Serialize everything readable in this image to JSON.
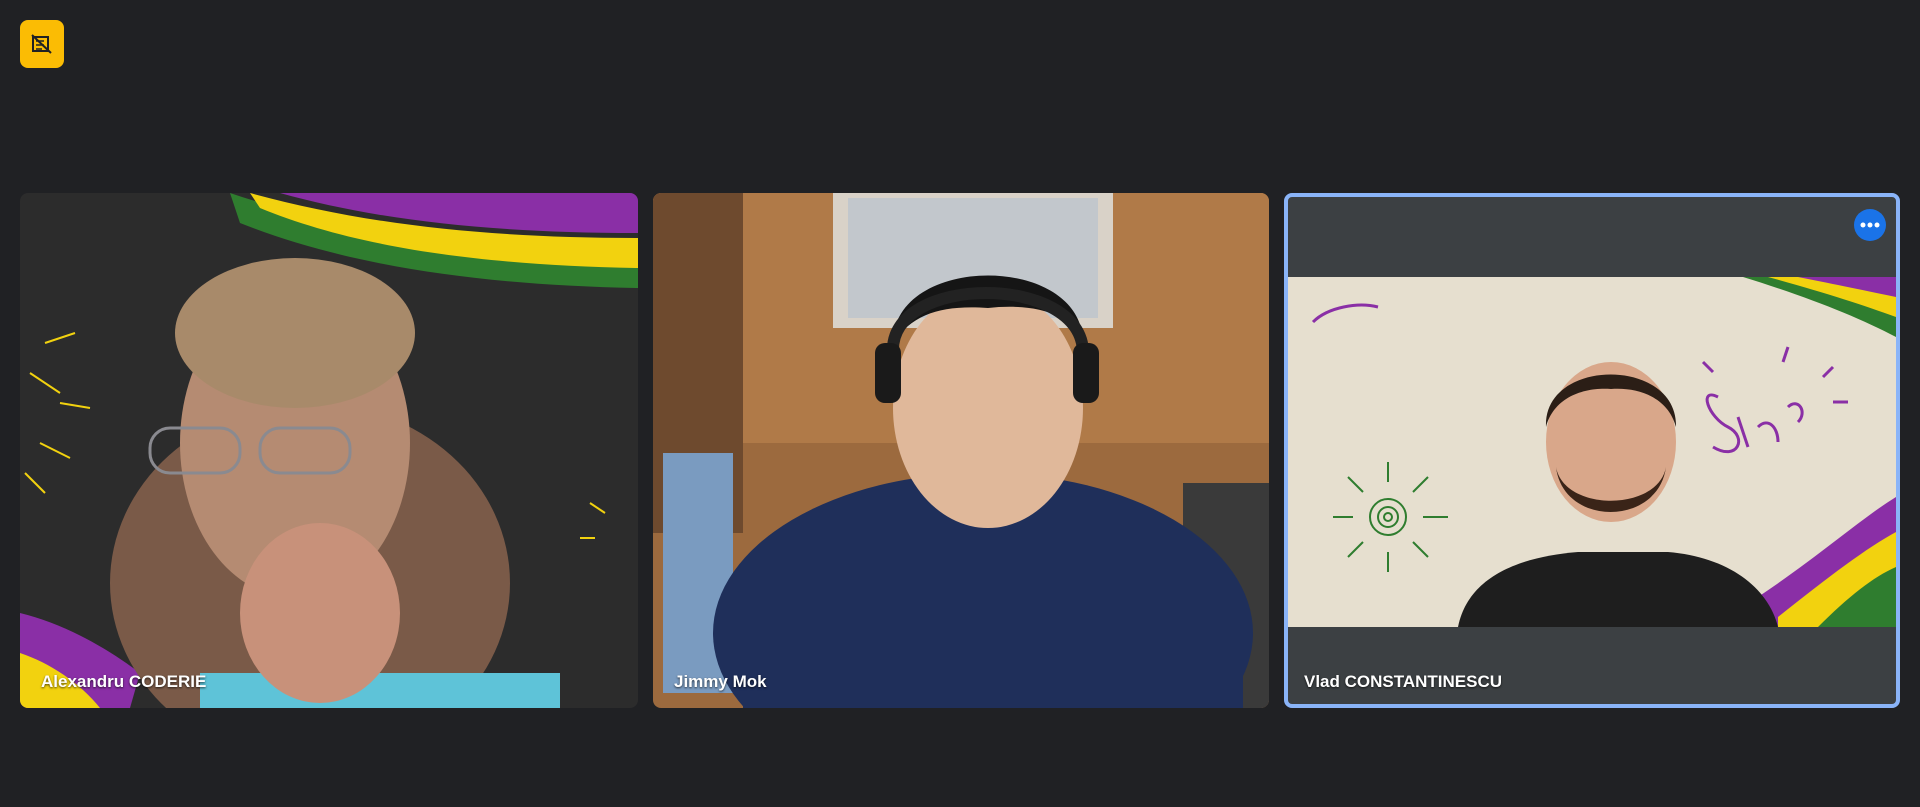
{
  "meeting": {
    "status_icon": "camera-off-icon",
    "accent_color": "#fbbc04",
    "highlight_color": "#8ab4f8"
  },
  "participants": [
    {
      "name": "Alexandru CODERIE"
    },
    {
      "name": "Jimmy Mok"
    },
    {
      "name": "Vlad CONSTANTINESCU",
      "active_speaker": true,
      "more_icon": "more-horizontal-icon"
    }
  ]
}
